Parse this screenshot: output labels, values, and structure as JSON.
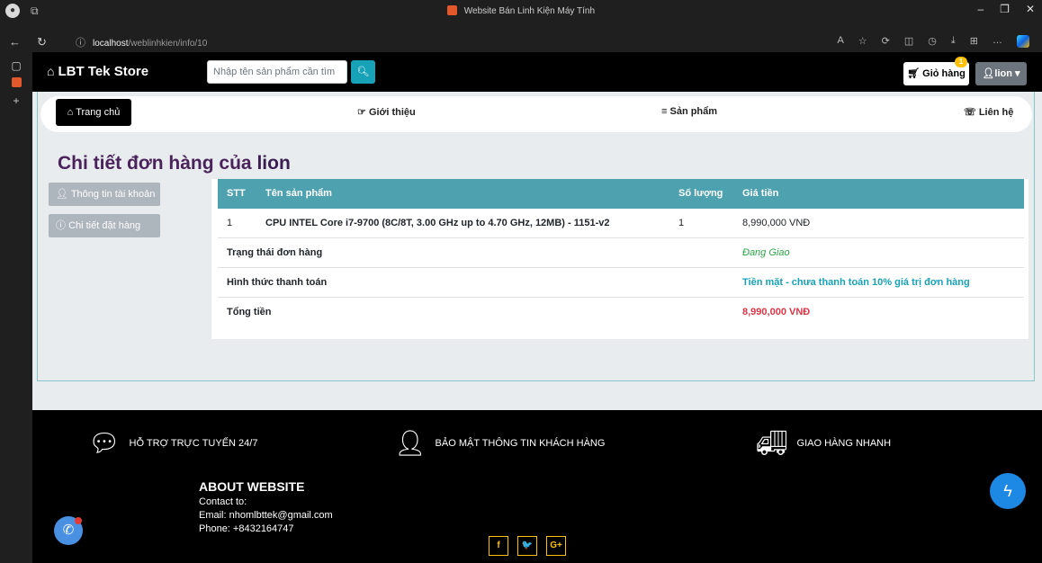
{
  "browser": {
    "tab_title": "Website Bán Linh Kiện Máy Tính",
    "url_host": "localhost",
    "url_path": "/weblinhkien/info/10"
  },
  "header": {
    "brand": "LBT Tek Store",
    "search_placeholder": "Nhập tên sản phẩm cần tìm",
    "cart_label": "Giỏ hàng",
    "cart_count": "1",
    "user_label": "lion"
  },
  "menu": {
    "home": "Trang chủ",
    "about": "Giới thiệu",
    "products": "Sản phẩm",
    "contact": "Liên hệ"
  },
  "page": {
    "heading_prefix": "Chi tiết đơn hàng của",
    "heading_user": "lion"
  },
  "side_menu": {
    "account": "Thông tin tài khoản",
    "order_detail": "Chi tiết đặt hàng"
  },
  "order_table": {
    "headers": {
      "stt": "STT",
      "product": "Tên sản phẩm",
      "qty": "Số lượng",
      "price": "Giá tiền"
    },
    "items": [
      {
        "stt": "1",
        "product": "CPU INTEL Core i7-9700 (8C/8T, 3.00 GHz up to 4.70 GHz, 12MB) - 1151-v2",
        "qty": "1",
        "price": "8,990,000 VNĐ"
      }
    ],
    "status_label": "Trạng thái đơn hàng",
    "status_value": "Đang Giao",
    "payment_label": "Hình thức thanh toán",
    "payment_value": "Tiền mặt - chưa thanh toán 10% giá trị đơn hàng",
    "total_label": "Tổng tiền",
    "total_value": "8,990,000 VNĐ"
  },
  "footer": {
    "feature_support": "HỖ TRỢ TRỰC TUYẾN 24/7",
    "feature_security": "BẢO MẬT THÔNG TIN KHÁCH HÀNG",
    "feature_delivery": "GIAO HÀNG NHANH",
    "about_title": "ABOUT WEBSITE",
    "contact_to": "Contact to:",
    "email": "Email: nhomlbttek@gmail.com",
    "phone": "Phone: +8432164747",
    "social_facebook": "f",
    "social_twitter": "🐦",
    "social_google": "G+"
  },
  "colors": {
    "table_header": "#4ea2b0",
    "status": "#28a745",
    "payment": "#17a2b8",
    "total": "#dc3545",
    "heading": "#4a235a"
  }
}
